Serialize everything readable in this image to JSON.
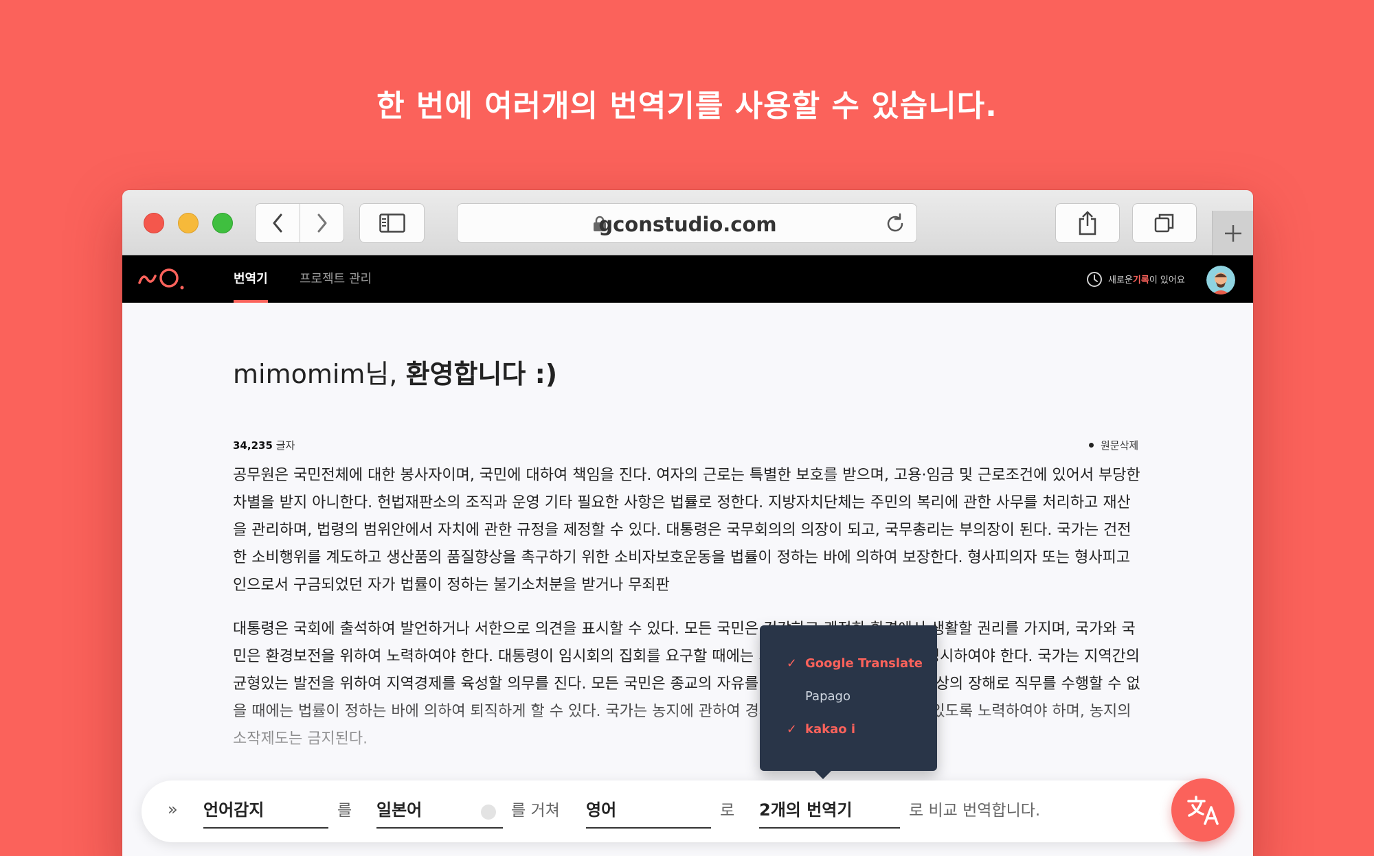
{
  "headline": "한 번에 여러개의 번역기를 사용할 수 있습니다.",
  "browser": {
    "url": "gconstudio.com"
  },
  "app": {
    "nav": [
      "번역기",
      "프로젝트 관리"
    ],
    "history_prefix": "새로운 ",
    "history_accent": "기록",
    "history_suffix": "이 있어요",
    "accent_color": "#fb625b"
  },
  "welcome": {
    "name": "mimomim님, ",
    "greeting": "환영합니다 :)"
  },
  "source": {
    "char_count": "34,235",
    "char_unit": " 글자",
    "delete_label": "원문삭제",
    "paragraph1": "공무원은 국민전체에 대한 봉사자이며, 국민에 대하여 책임을 진다. 여자의 근로는 특별한 보호를 받으며, 고용·임금 및 근로조건에 있어서 부당한 차별을 받지 아니한다. 헌법재판소의 조직과 운영 기타 필요한 사항은 법률로 정한다. 지방자치단체는 주민의 복리에 관한 사무를 처리하고 재산을 관리하며, 법령의 범위안에서 자치에 관한 규정을 제정할 수 있다. 대통령은 국무회의의 의장이 되고, 국무총리는 부의장이 된다. 국가는 건전한 소비행위를 계도하고 생산품의 품질향상을 촉구하기 위한 소비자보호운동을 법률이 정하는 바에 의하여 보장한다. 형사피의자 또는 형사피고인으로서 구금되었던 자가 법률이 정하는 불기소처분을 받거나 무죄판",
    "paragraph2": "대통령은 국회에 출석하여 발언하거나 서한으로 의견을 표시할 수 있다. 모든 국민은 건강하고 쾌적한 환경에서 생활할 권리를 가지며, 국가와 국민은 환경보전을 위하여 노력하여야 한다. 대통령이 임시회의 집회를 요구할 때에는 기간과 집회요구의 이유를 명시하여야 한다. 국가는 지역간의 균형있는 발전을 위하여 지역경제를 육성할 의무를 진다. 모든 국민은 종교의 자유를 가진다. 법관이 중대한 심신상의 장해로 직무를 수행할 수 없을 때에는 법률이 정하는 바에 의하여 퇴직하게 할 수 있다. 국가는 농지에 관하여 경자유전의 원칙이 달성될 수 있도록 노력하여야 하며, 농지의 소작제도는 금지된다."
  },
  "translator_menu": {
    "items": [
      {
        "label": "Google Translate",
        "checked": true,
        "check": "✓"
      },
      {
        "label": "Papago",
        "checked": false,
        "check": ""
      },
      {
        "label": "kakao i",
        "checked": true,
        "check": "✓"
      }
    ]
  },
  "toolbar": {
    "chevron": "»",
    "source_lang": "언어감지",
    "particle1": "를",
    "via_lang": "일본어",
    "via_text": "를 거쳐",
    "target_lang": "영어",
    "particle2": "로",
    "translator_count": "2개의 번역기",
    "suffix": "로 비교 번역합니다."
  }
}
